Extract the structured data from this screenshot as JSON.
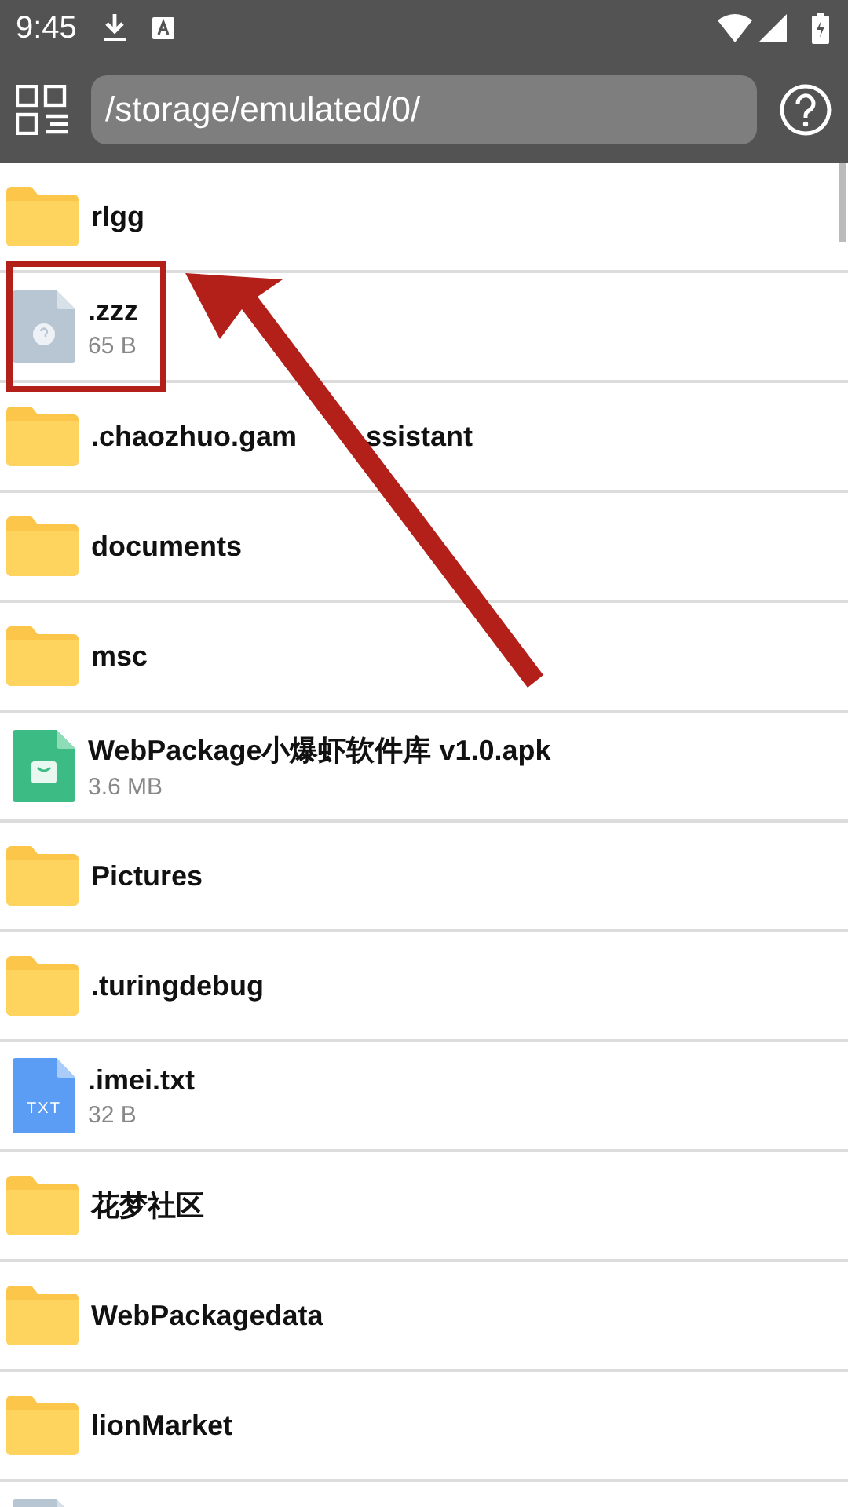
{
  "status_bar": {
    "time": "9:45"
  },
  "toolbar": {
    "path": "/storage/emulated/0/"
  },
  "files": [
    {
      "kind": "folder",
      "name": "rlgg"
    },
    {
      "kind": "unknown",
      "name": ".zzz",
      "size": "65 B",
      "highlighted": true
    },
    {
      "kind": "folder",
      "name": ".chaozhuo.gam",
      "name_continued": "ssistant"
    },
    {
      "kind": "folder",
      "name": "documents"
    },
    {
      "kind": "folder",
      "name": "msc"
    },
    {
      "kind": "apk",
      "name": "WebPackage小爆虾软件库 v1.0.apk",
      "size": "3.6 MB"
    },
    {
      "kind": "folder",
      "name": "Pictures"
    },
    {
      "kind": "folder",
      "name": ".turingdebug"
    },
    {
      "kind": "txt",
      "name": ".imei.txt",
      "size": "32 B",
      "icon_label": "TXT"
    },
    {
      "kind": "folder",
      "name": "花梦社区"
    },
    {
      "kind": "folder",
      "name": "WebPackagedata"
    },
    {
      "kind": "folder",
      "name": "lionMarket"
    },
    {
      "kind": "unknown"
    }
  ]
}
